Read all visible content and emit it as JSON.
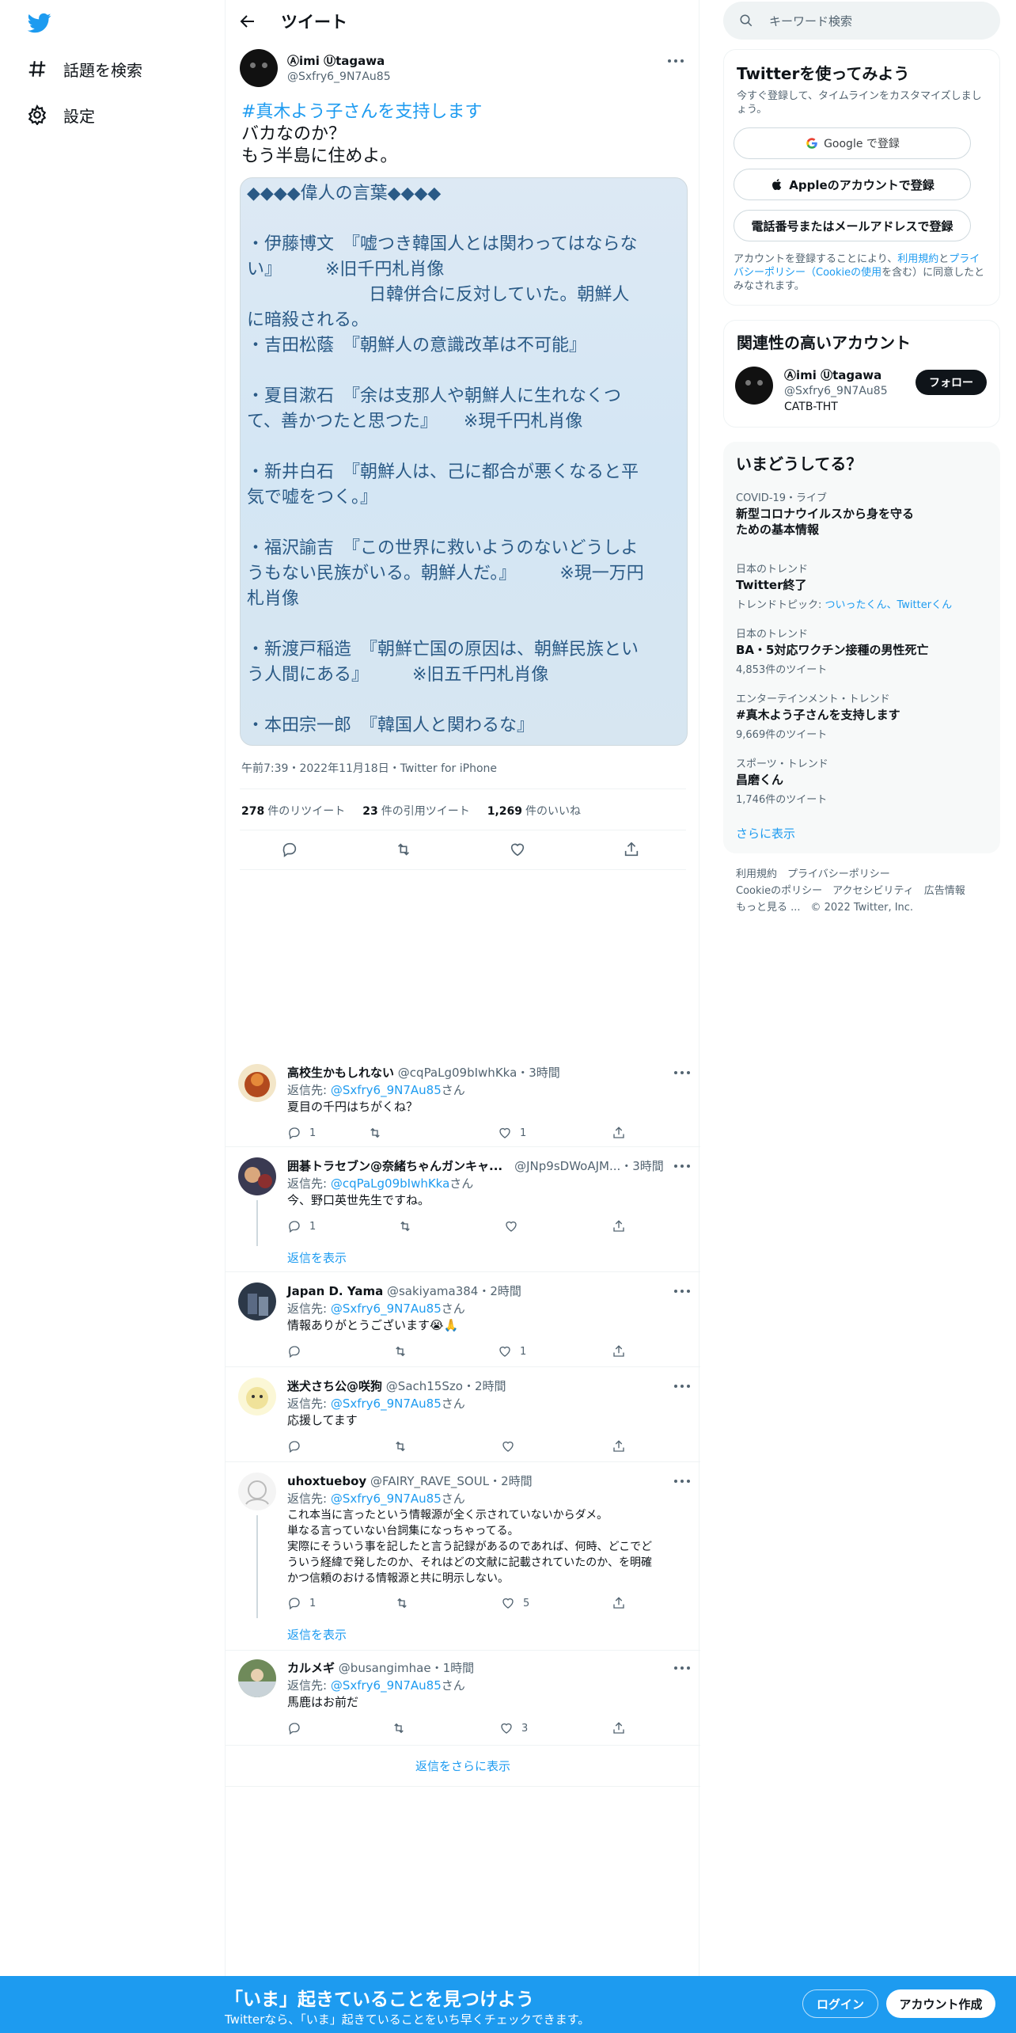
{
  "nav": {
    "explore": "話題を検索",
    "settings": "設定"
  },
  "header": {
    "title": "ツイート"
  },
  "tweet": {
    "name": "Ⓐimi Ⓤtagawa",
    "handle": "@Sxfry6_9N7Au85",
    "hashtag": "#真木よう子さんを支持します",
    "lines": [
      "バカなのか？",
      "もう半島に住めよ。"
    ],
    "image_lines": [
      "◆◆◆◆偉人の言葉◆◆◆◆",
      "",
      "・伊藤博文　『嘘つき韓国人とは関わってはならな",
      "い』　　　※旧千円札肖像",
      "　　　　　　　日韓併合に反対していた。朝鮮人",
      "に暗殺される。",
      "・吉田松蔭　『朝鮮人の意識改革は不可能』",
      "",
      "・夏目漱石　『余は支那人や朝鮮人に生れなくつ",
      "て、善かつたと思つた』　　※現千円札肖像",
      "",
      "・新井白石　『朝鮮人は、己に都合が悪くなると平",
      "気で嘘をつく。』",
      "",
      "・福沢諭吉　『この世界に救いようのないどうしよ",
      "うもない民族がいる。朝鮮人だ。』　　　※現一万円",
      "札肖像",
      "",
      "・新渡戸稲造　『朝鮮亡国の原因は、朝鮮民族とい",
      "う人間にある』　　　※旧五千円札肖像",
      "",
      "・本田宗一郎　『韓国人と関わるな』"
    ],
    "meta": "午前7:39・2022年11月18日・Twitter for iPhone",
    "retweets": "278",
    "retweets_label": "件のリツイート",
    "quotes": "23",
    "quotes_label": "件の引用ツイート",
    "likes": "1,269",
    "likes_label": "件のいいね"
  },
  "replies": [
    {
      "name": "高校生かもしれない",
      "handle": "@cqPaLg09bIwhKka",
      "time": "・3時間",
      "to_label": "返信先: ",
      "to": "@Sxfry6_9N7Au85",
      "san": "さん",
      "body": [
        "夏目の千円はちがくね？"
      ],
      "reply_count": "1",
      "rt_count": "",
      "like_count": "1"
    },
    {
      "name": "囲碁トラセブン@奈緒ちゃんガンキャ...",
      "handle": "@JNp9sDWoAJM...",
      "time": "・3時間",
      "to_label": "返信先: ",
      "to": "@cqPaLg09bIwhKka",
      "san": "さん",
      "body": [
        "今、野口英世先生ですね。"
      ],
      "reply_count": "1",
      "rt_count": "",
      "like_count": ""
    },
    {
      "name": "Japan D. Yama",
      "handle": "@sakiyama384",
      "time": "・2時間",
      "to_label": "返信先: ",
      "to": "@Sxfry6_9N7Au85",
      "san": "さん",
      "body": [
        "情報ありがとうございます😭🙏"
      ],
      "reply_count": "",
      "rt_count": "",
      "like_count": "1"
    },
    {
      "name": "迷犬さち公@咲狗",
      "handle": "@Sach15Szo",
      "time": "・2時間",
      "to_label": "返信先: ",
      "to": "@Sxfry6_9N7Au85",
      "san": "さん",
      "body": [
        "応援してます"
      ],
      "reply_count": "",
      "rt_count": "",
      "like_count": ""
    },
    {
      "name": "uhoxtueboy",
      "handle": "@FAIRY_RAVE_SOUL",
      "time": "・2時間",
      "to_label": "返信先: ",
      "to": "@Sxfry6_9N7Au85",
      "san": "さん",
      "body": [
        "これ本当に言ったという情報源が全く示されていないからダメ。",
        "単なる言っていない台詞集になっちゃってる。",
        "実際にそういう事を記したと言う記録があるのであれば、何時、どこでど",
        "ういう経緯で発したのか、それはどの文献に記載されていたのか、を明確",
        "かつ信頼のおける情報源と共に明示しない。"
      ],
      "reply_count": "1",
      "rt_count": "",
      "like_count": "5"
    },
    {
      "name": "カルメギ",
      "handle": "@busangimhae",
      "time": "・1時間",
      "to_label": "返信先: ",
      "to": "@Sxfry6_9N7Au85",
      "san": "さん",
      "body": [
        "馬鹿はお前だ"
      ],
      "reply_count": "",
      "rt_count": "",
      "like_count": "3"
    }
  ],
  "show_replies": "返信を表示",
  "more_replies": "返信をさらに表示",
  "search": {
    "placeholder": "キーワード検索"
  },
  "signup": {
    "title": "Twitterを使ってみよう",
    "desc": "今すぐ登録して、タイムラインをカスタマイズしましょう。",
    "google": "Google で登録",
    "apple": "Appleのアカウントで登録",
    "phone": "電話番号またはメールアドレスで登録",
    "terms_pre": "アカウントを登録することにより、",
    "terms_link1": "利用規約",
    "terms_mid": "と",
    "terms_link2": "プライバシーポリシー（Cookieの使用",
    "terms_post": "を含む）に同意したとみなされます。"
  },
  "related": {
    "title": "関連性の高いアカウント",
    "name": "Ⓐimi Ⓤtagawa",
    "handle": "@Sxfry6_9N7Au85",
    "bio": "CATB-THT",
    "follow": "フォロー"
  },
  "trends": {
    "title": "いまどうしてる？",
    "items": [
      {
        "context": "COVID-19・ライブ",
        "title": "新型コロナウイルスから身を守るための基本情報",
        "extra": ""
      },
      {
        "context": "日本のトレンド",
        "title": "Twitter終了",
        "extra": "トレンドトピック: ",
        "extra_link": "ついったくん、Twitterくん"
      },
      {
        "context": "日本のトレンド",
        "title": "BA・5対応ワクチン接種の男性死亡",
        "extra": "4,853件のツイート"
      },
      {
        "context": "エンターテインメント・トレンド",
        "title": "#真木よう子さんを支持します",
        "extra": "9,669件のツイート"
      },
      {
        "context": "スポーツ・トレンド",
        "title": "昌磨くん",
        "extra": "1,746件のツイート"
      }
    ],
    "show_more": "さらに表示"
  },
  "footer": {
    "line1": "利用規約　プライバシーポリシー",
    "line2": "Cookieのポリシー　アクセシビリティ　広告情報",
    "line3": "もっと見る ...　© 2022 Twitter, Inc."
  },
  "bottom": {
    "title": "「いま」起きていることを見つけよう",
    "sub": "Twitterなら、「いま」起きていることをいち早くチェックできます。",
    "login": "ログイン",
    "signup": "アカウント作成"
  },
  "colors": {
    "accent": "#1d9bf0",
    "text": "#0f1419",
    "muted": "#536471"
  }
}
